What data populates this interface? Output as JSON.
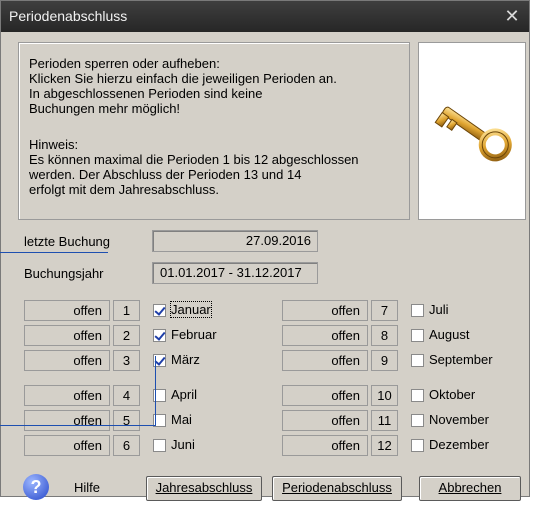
{
  "window": {
    "title": "Periodenabschluss"
  },
  "info": {
    "intro": "Perioden sperren oder aufheben:\nKlicken Sie hierzu einfach die jeweiligen Perioden an.\nIn abgeschlossenen Perioden sind keine\nBuchungen mehr möglich!",
    "hint": "Hinweis:\nEs können maximal die Perioden 1 bis 12 abgeschlossen\nwerden. Der Abschluss der Perioden 13 und 14\nerfolgt mit dem Jahresabschluss."
  },
  "image": "key-icon",
  "fields": {
    "last_booking_label": "letzte Buchung",
    "last_booking_value": "27.09.2016",
    "year_label": "Buchungsjahr",
    "year_value": "01.01.2017 - 31.12.2017"
  },
  "periods": [
    {
      "status": "offen",
      "num": "1",
      "month": "Januar",
      "checked": true
    },
    {
      "status": "offen",
      "num": "2",
      "month": "Februar",
      "checked": true
    },
    {
      "status": "offen",
      "num": "3",
      "month": "März",
      "checked": true
    },
    {
      "status": "offen",
      "num": "4",
      "month": "April",
      "checked": false
    },
    {
      "status": "offen",
      "num": "5",
      "month": "Mai",
      "checked": false
    },
    {
      "status": "offen",
      "num": "6",
      "month": "Juni",
      "checked": false
    },
    {
      "status": "offen",
      "num": "7",
      "month": "Juli",
      "checked": false
    },
    {
      "status": "offen",
      "num": "8",
      "month": "August",
      "checked": false
    },
    {
      "status": "offen",
      "num": "9",
      "month": "September",
      "checked": false
    },
    {
      "status": "offen",
      "num": "10",
      "month": "Oktober",
      "checked": false
    },
    {
      "status": "offen",
      "num": "11",
      "month": "November",
      "checked": false
    },
    {
      "status": "offen",
      "num": "12",
      "month": "Dezember",
      "checked": false
    }
  ],
  "buttons": {
    "help": "Hilfe",
    "year_end": "Jahresabschluss",
    "period_end": "Periodenabschluss",
    "cancel": "Abbrechen"
  },
  "colors": {
    "titlebar": "#262626",
    "dialog": "#d4d0c8",
    "callout": "#1e4fb0"
  }
}
